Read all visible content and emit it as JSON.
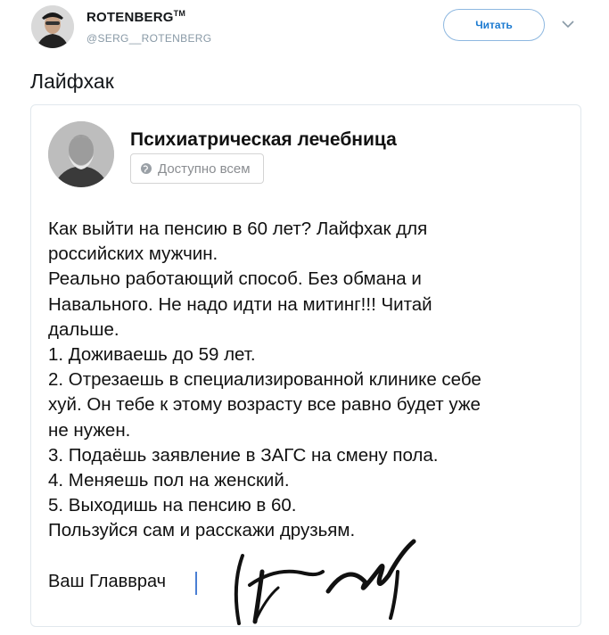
{
  "header": {
    "user_name": "ROTENBERG",
    "trademark": "TM",
    "user_handle": "@SERG__ROTENBERG",
    "follow_label": "Читать"
  },
  "tweet": {
    "text": "Лайфхак"
  },
  "card": {
    "group_title": "Психиатрическая лечебница",
    "privacy_label": "Доступно всем",
    "body_lines": [
      "Как выйти на пенсию в 60 лет? Лайфхак для",
      "российских мужчин.",
      "Реально работающий способ. Без обмана и",
      "Навального. Не надо идти на митинг!!! Читай",
      "дальше.",
      "1. Доживаешь до 59 лет.",
      "2. Отрезаешь в специализированной клинике себе",
      "хуй. Он тебе к этому возрасту все равно будет уже",
      "не нужен.",
      "3. Подаёшь заявление в ЗАГС на смену пола.",
      "4. Меняешь пол на женский.",
      "5. Выходишь на пенсию в 60.",
      "Пользуйся сам и расскажи друзьям."
    ],
    "sign_label": "Ваш Главврач"
  },
  "colors": {
    "accent": "#1b7ad1",
    "handle": "#8899a6",
    "border": "#e1e8ed"
  }
}
